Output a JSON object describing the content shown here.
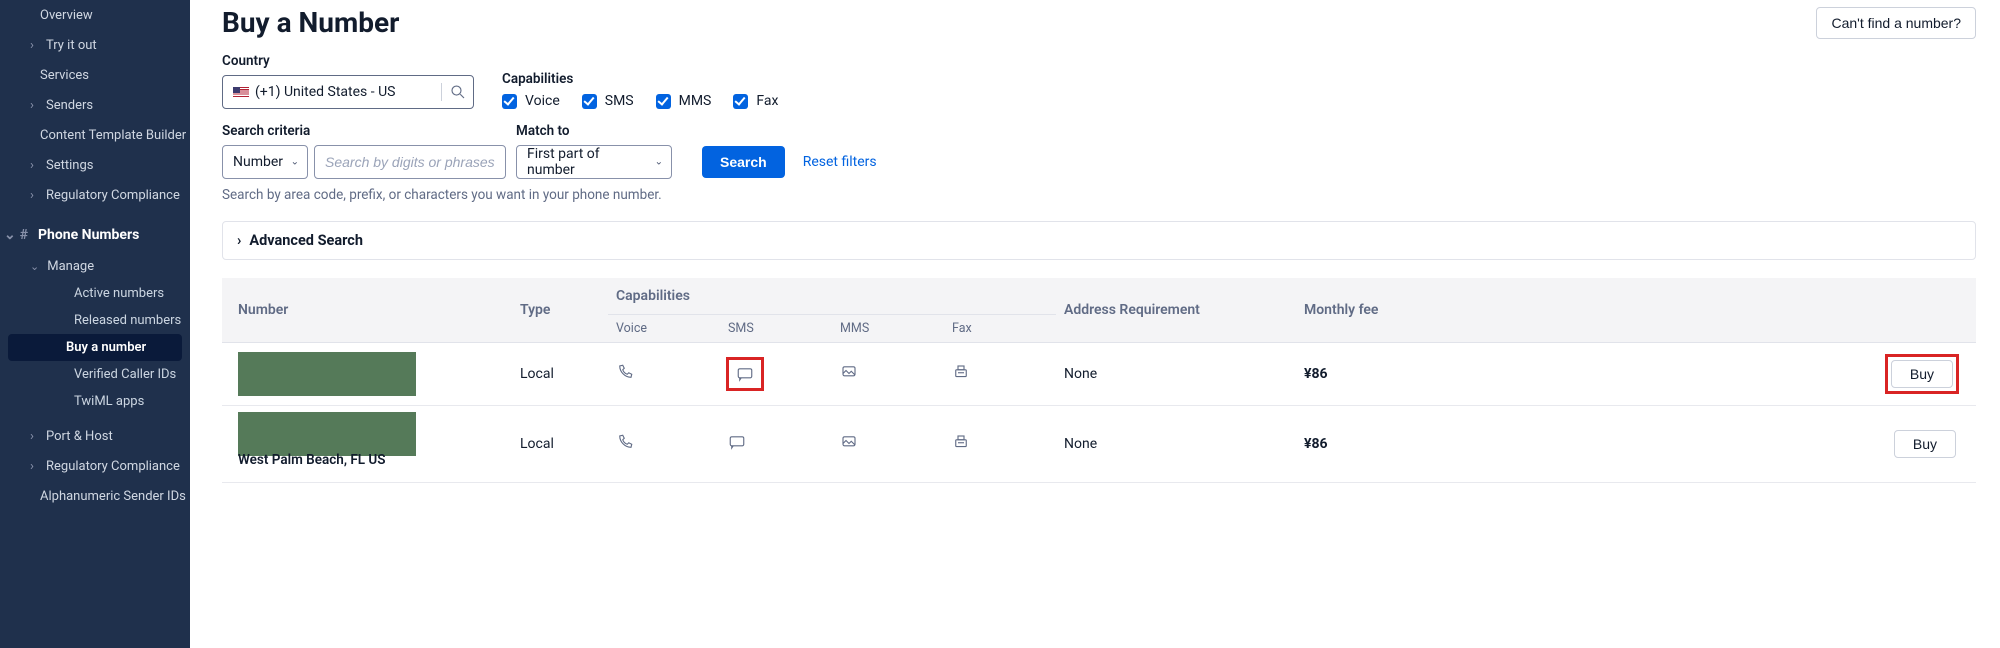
{
  "sidebar": {
    "top": [
      {
        "label": "Overview",
        "chev": false
      },
      {
        "label": "Try it out",
        "chev": true
      },
      {
        "label": "Services",
        "chev": false
      },
      {
        "label": "Senders",
        "chev": true
      },
      {
        "label": "Content Template Builder",
        "chev": false
      },
      {
        "label": "Settings",
        "chev": true
      },
      {
        "label": "Regulatory Compliance",
        "chev": true
      }
    ],
    "section": "Phone Numbers",
    "manage_label": "Manage",
    "manage": [
      {
        "label": "Active numbers"
      },
      {
        "label": "Released numbers"
      },
      {
        "label": "Buy a number",
        "active": true
      },
      {
        "label": "Verified Caller IDs"
      },
      {
        "label": "TwiML apps"
      }
    ],
    "bottom": [
      {
        "label": "Port & Host",
        "chev": true
      },
      {
        "label": "Regulatory Compliance",
        "chev": true
      },
      {
        "label": "Alphanumeric Sender IDs",
        "chev": false
      }
    ]
  },
  "header": {
    "title": "Buy a Number",
    "cant_find": "Can't find a number?"
  },
  "filters": {
    "country_label": "Country",
    "country_value": "(+1) United States - US",
    "caps_label": "Capabilities",
    "caps": [
      "Voice",
      "SMS",
      "MMS",
      "Fax"
    ],
    "criteria_label": "Search criteria",
    "criteria_select": "Number",
    "criteria_placeholder": "Search by digits or phrases",
    "match_label": "Match to",
    "match_value": "First part of number",
    "search_btn": "Search",
    "reset": "Reset filters",
    "hint": "Search by area code, prefix, or characters you want in your phone number.",
    "advanced": "Advanced Search"
  },
  "table": {
    "cols": {
      "number": "Number",
      "type": "Type",
      "caps": "Capabilities",
      "addr": "Address Requirement",
      "fee": "Monthly fee"
    },
    "subcaps": [
      "Voice",
      "SMS",
      "MMS",
      "Fax"
    ],
    "rows": [
      {
        "type": "Local",
        "addr": "None",
        "fee": "¥86",
        "buy": "Buy",
        "highlight": true
      },
      {
        "type": "Local",
        "addr": "None",
        "fee": "¥86",
        "buy": "Buy",
        "location": "West Palm Beach, FL US"
      }
    ]
  }
}
